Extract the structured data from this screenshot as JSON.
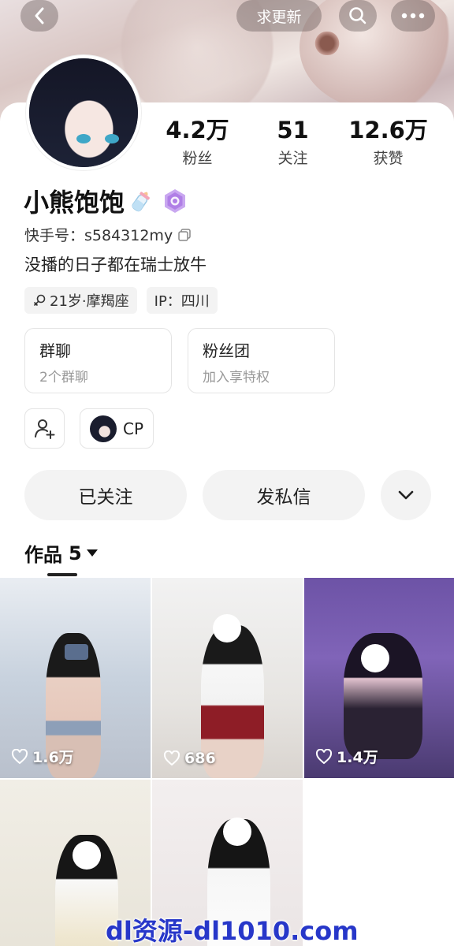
{
  "header": {
    "update_label": "求更新",
    "icons": [
      "back-icon",
      "search-icon",
      "more-icon"
    ]
  },
  "profile": {
    "stats": [
      {
        "value": "4.2万",
        "label": "粉丝"
      },
      {
        "value": "51",
        "label": "关注"
      },
      {
        "value": "12.6万",
        "label": "获赞"
      }
    ],
    "name": "小熊饱饱",
    "id_label": "快手号：s584312my",
    "bio": "没播的日子都在瑞士放牛",
    "tags": [
      {
        "icon": "female-icon",
        "text": "21岁·摩羯座"
      },
      {
        "icon": "",
        "text": "IP：四川"
      }
    ]
  },
  "cards": {
    "group_chat": {
      "title": "群聊",
      "subtitle": "2个群聊"
    },
    "fan_club": {
      "title": "粉丝团",
      "subtitle": "加入享特权"
    }
  },
  "cp": {
    "label": "CP"
  },
  "actions": {
    "follow_label": "已关注",
    "message_label": "发私信"
  },
  "works": {
    "tab_label": "作品",
    "count": "5",
    "items": [
      {
        "likes": "1.6万"
      },
      {
        "likes": "686"
      },
      {
        "likes": "1.4万"
      },
      {
        "likes": ""
      },
      {
        "likes": ""
      }
    ]
  },
  "watermark": "dl资源-dl1010.com",
  "colors": {
    "accent": "#2737c9",
    "pill_bg": "#f3f3f3",
    "badge": "#b58be0"
  }
}
